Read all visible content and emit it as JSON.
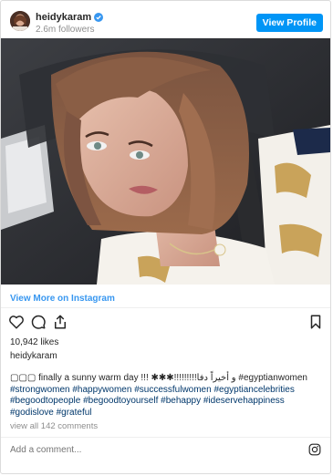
{
  "header": {
    "username": "heidykaram",
    "followers": "2.6m followers",
    "view_profile_label": "View Profile"
  },
  "post": {
    "view_more_label": "View More on Instagram",
    "likes": "10,942 likes",
    "poster_username": "heidykaram",
    "caption_text": "▢▢▢ finally a sunny warm day !!! ✱✱✱!!!!!!!!!و أخيراً دفا #egyptianwomen",
    "caption_hashtags": "#strongwomen #happywomen #successfulwomen #egyptiancelebrities #begoodtopeople #begoodtoyourself #behappy #ideservehappiness #godislove #grateful",
    "view_comments_label": "view all 142 comments",
    "comment_placeholder": "Add a comment..."
  },
  "icons": [
    "verified-badge-icon",
    "heart-icon",
    "comment-icon",
    "share-icon",
    "bookmark-icon",
    "instagram-icon"
  ],
  "colors": {
    "accent": "#0095f6",
    "link": "#3897f0",
    "muted": "#8e8e8e",
    "text": "#262626"
  }
}
